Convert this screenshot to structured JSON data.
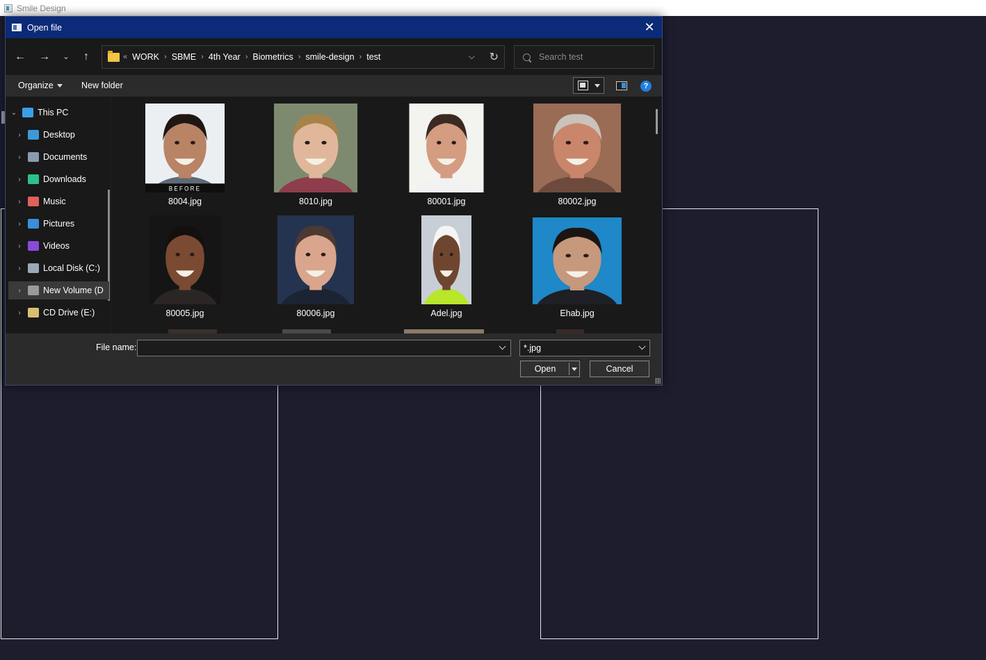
{
  "app": {
    "title": "Smile Design"
  },
  "dialog": {
    "title": "Open file",
    "breadcrumb": {
      "overflow": "«",
      "items": [
        "WORK",
        "SBME",
        "4th Year",
        "Biometrics",
        "smile-design",
        "test"
      ]
    },
    "search": {
      "placeholder": "Search test"
    },
    "toolbar": {
      "organize": "Organize",
      "new_folder": "New folder"
    },
    "sidebar": [
      {
        "label": "This PC",
        "icon": "computer-icon",
        "color": "#3aa0e8",
        "expanded": true
      },
      {
        "label": "Desktop",
        "icon": "desktop-icon",
        "color": "#3a9ad8"
      },
      {
        "label": "Documents",
        "icon": "documents-icon",
        "color": "#8a9ab0"
      },
      {
        "label": "Downloads",
        "icon": "downloads-icon",
        "color": "#2fbf8a"
      },
      {
        "label": "Music",
        "icon": "music-icon",
        "color": "#e0605a"
      },
      {
        "label": "Pictures",
        "icon": "pictures-icon",
        "color": "#3a8fd8"
      },
      {
        "label": "Videos",
        "icon": "videos-icon",
        "color": "#8a4ad8"
      },
      {
        "label": "Local Disk (C:)",
        "icon": "local-disk-icon",
        "color": "#9aa8b8"
      },
      {
        "label": "New Volume (D",
        "icon": "drive-icon",
        "color": "#9a9a9a",
        "selected": true
      },
      {
        "label": "CD Drive (E:)",
        "icon": "cd-drive-icon",
        "color": "#d8c070"
      }
    ],
    "files": [
      {
        "name": "8004.jpg",
        "bg": "#eceff1",
        "skin": "#b98365",
        "hair": "#1e1714",
        "shirt": "#5d6a75",
        "caption": "BEFORE"
      },
      {
        "name": "8010.jpg",
        "bg": "#7d8a6f",
        "skin": "#e0b79a",
        "hair": "#a58349",
        "shirt": "#8d3d4b"
      },
      {
        "name": "80001.jpg",
        "bg": "#f3f3ef",
        "skin": "#d49c80",
        "hair": "#3a2a22",
        "shirt": "#f2f2f2"
      },
      {
        "name": "80002.jpg",
        "bg": "#9a6b55",
        "skin": "#c9866b",
        "hair": "#c9c3bc",
        "shirt": "#6d4a3c"
      },
      {
        "name": "80005.jpg",
        "bg": "#151515",
        "skin": "#7a4a32",
        "hair": "#141010",
        "shirt": "#2b2624"
      },
      {
        "name": "80006.jpg",
        "bg": "#24334f",
        "skin": "#d9a58c",
        "hair": "#4a3a33",
        "shirt": "#1c2333"
      },
      {
        "name": "Adel.jpg",
        "bg": "#c8ced6",
        "skin": "#6e4630",
        "hair": "#f5f5f5",
        "shirt": "#b8e62a"
      },
      {
        "name": "Ehab.jpg",
        "bg": "#1e88c8",
        "skin": "#c6987c",
        "hair": "#1b1512",
        "shirt": "#1f1f26"
      }
    ],
    "file_name": {
      "label": "File name:",
      "value": ""
    },
    "filter": "*.jpg",
    "buttons": {
      "open": "Open",
      "cancel": "Cancel"
    }
  }
}
